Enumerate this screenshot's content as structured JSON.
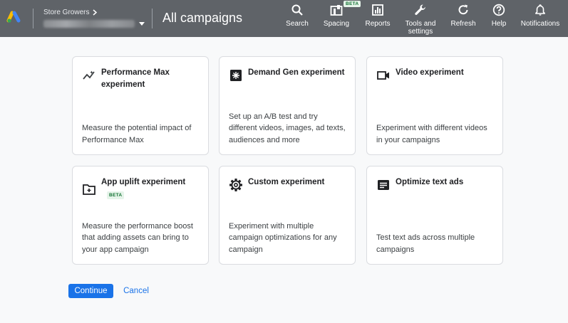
{
  "header": {
    "account_name": "Store Growers",
    "page_title": "All campaigns",
    "tools": [
      {
        "label": "Search",
        "icon": "search-icon"
      },
      {
        "label": "Spacing",
        "icon": "spacing-icon",
        "badge": "BETA"
      },
      {
        "label": "Reports",
        "icon": "reports-icon"
      },
      {
        "label": "Tools and settings",
        "icon": "wrench-icon"
      },
      {
        "label": "Refresh",
        "icon": "refresh-icon"
      },
      {
        "label": "Help",
        "icon": "help-icon"
      },
      {
        "label": "Notifications",
        "icon": "bell-icon"
      }
    ]
  },
  "cards": [
    {
      "title": "Performance Max experiment",
      "description": "Measure the potential impact of Performance Max",
      "icon": "performance-max-icon"
    },
    {
      "title": "Demand Gen experiment",
      "description": "Set up an A/B test and try different videos, images, ad texts, audiences and more",
      "icon": "demand-gen-icon"
    },
    {
      "title": "Video experiment",
      "description": "Experiment with different videos in your campaigns",
      "icon": "video-camera-icon"
    },
    {
      "title": "App uplift experiment",
      "badge": "BETA",
      "description": "Measure the performance boost that adding assets can bring to your app campaign",
      "icon": "app-uplift-icon"
    },
    {
      "title": "Custom experiment",
      "description": "Experiment with multiple campaign optimizations for any campaign",
      "icon": "gear-icon"
    },
    {
      "title": "Optimize text ads",
      "description": "Test text ads across multiple campaigns",
      "icon": "text-ad-icon"
    }
  ],
  "actions": {
    "continue_label": "Continue",
    "cancel_label": "Cancel"
  },
  "colors": {
    "topbar": "#5f6368",
    "primary": "#1a73e8",
    "beta_bg": "#e6f4ea",
    "beta_text": "#137333"
  }
}
